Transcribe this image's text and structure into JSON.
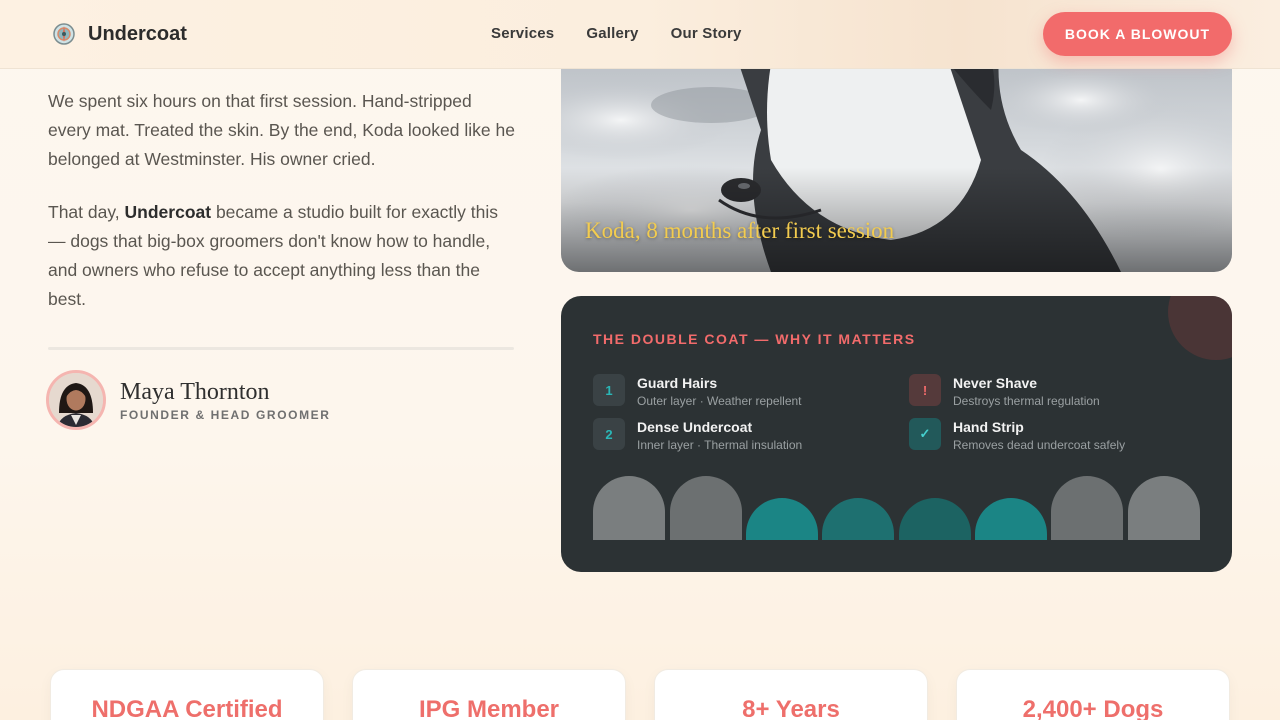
{
  "header": {
    "brand": "Undercoat",
    "nav": [
      "Services",
      "Gallery",
      "Our Story"
    ],
    "cta": "BOOK A BLOWOUT"
  },
  "story": {
    "p1": "We spent six hours on that first session. Hand-stripped every mat. Treated the skin. By the end, Koda looked like he belonged at Westminster. His owner cried.",
    "p2_before": "That day, ",
    "p2_bold": "Undercoat",
    "p2_after": " became a studio built for exactly this — dogs that big-box groomers don't know how to handle, and owners who refuse to accept anything less than the best."
  },
  "founder": {
    "name": "Maya Thornton",
    "role": "FOUNDER & HEAD GROOMER"
  },
  "photo": {
    "caption": "Koda, 8 months after first session"
  },
  "coat_card": {
    "title": "THE DOUBLE COAT — WHY IT MATTERS",
    "features": [
      {
        "badge": "1",
        "title": "Guard Hairs",
        "sub": "Outer layer · Weather repellent"
      },
      {
        "badge": "2",
        "title": "Dense Undercoat",
        "sub": "Inner layer · Thermal insulation"
      },
      {
        "badge": "!",
        "title": "Never Shave",
        "sub": "Destroys thermal regulation"
      },
      {
        "badge": "✓",
        "title": "Hand Strip",
        "sub": "Removes dead undercoat safely"
      }
    ]
  },
  "stats": [
    "NDGAA Certified",
    "IPG Member",
    "8+ Years",
    "2,400+ Dogs"
  ],
  "colors": {
    "accent": "#f26b6b",
    "dark_card": "#2c3234",
    "teal": "#1f8585",
    "caption": "#f3cc4f"
  }
}
